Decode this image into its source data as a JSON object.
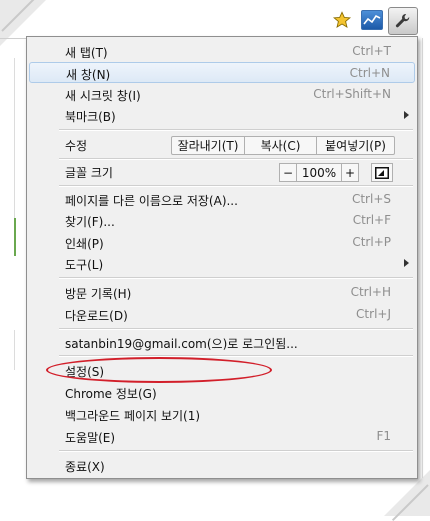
{
  "toolbar": {
    "icons": [
      "star-icon",
      "extension-chart-icon",
      "wrench-icon"
    ],
    "accent_color": "#4d8fd8"
  },
  "menu": {
    "items": [
      {
        "label": "새 탭(T)",
        "shortcut": "Ctrl+T"
      },
      {
        "label": "새 창(N)",
        "shortcut": "Ctrl+N"
      },
      {
        "label": "새 시크릿 창(I)",
        "shortcut": "Ctrl+Shift+N"
      },
      {
        "label": "북마크(B)",
        "shortcut": ""
      }
    ],
    "edit": {
      "label": "수정",
      "cut": "잘라내기(T)",
      "copy": "복사(C)",
      "paste": "붙여넣기(P)"
    },
    "zoom": {
      "label": "글꼴 크기",
      "minus": "−",
      "value": "100%",
      "plus": "+"
    },
    "items2": [
      {
        "label": "페이지를 다른 이름으로 저장(A)...",
        "shortcut": "Ctrl+S"
      },
      {
        "label": "찾기(F)...",
        "shortcut": "Ctrl+F"
      },
      {
        "label": "인쇄(P)",
        "shortcut": "Ctrl+P"
      },
      {
        "label": "도구(L)",
        "shortcut": ""
      }
    ],
    "items3": [
      {
        "label": "방문 기록(H)",
        "shortcut": "Ctrl+H"
      },
      {
        "label": "다운로드(D)",
        "shortcut": "Ctrl+J"
      }
    ],
    "account": {
      "label": "satanbin19@gmail.com(으)로 로그인됨..."
    },
    "items4": [
      {
        "label": "설정(S)",
        "shortcut": ""
      },
      {
        "label": "Chrome 정보(G)",
        "shortcut": ""
      },
      {
        "label": "백그라운드 페이지 보기(1)",
        "shortcut": ""
      },
      {
        "label": "도움말(E)",
        "shortcut": "F1"
      }
    ],
    "exit": {
      "label": "종료(X)"
    },
    "highlight_color": "#d21f2a"
  }
}
